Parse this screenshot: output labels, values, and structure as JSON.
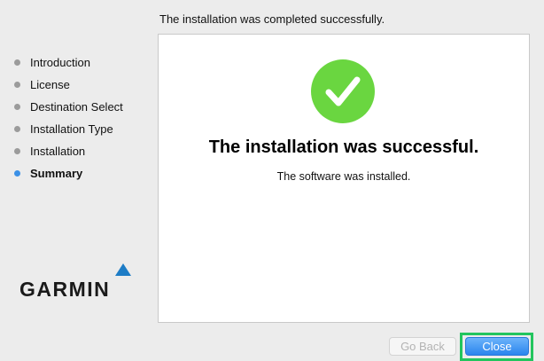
{
  "header": {
    "status_text": "The installation was completed successfully."
  },
  "sidebar": {
    "steps": [
      {
        "label": "Introduction",
        "state": "done"
      },
      {
        "label": "License",
        "state": "done"
      },
      {
        "label": "Destination Select",
        "state": "done"
      },
      {
        "label": "Installation Type",
        "state": "done"
      },
      {
        "label": "Installation",
        "state": "done"
      },
      {
        "label": "Summary",
        "state": "current"
      }
    ],
    "logo_text": "GARMIN"
  },
  "main": {
    "icon": "success-check-icon",
    "title": "The installation was successful.",
    "subtitle": "The software was installed."
  },
  "footer": {
    "back_label": "Go Back",
    "back_enabled": false,
    "close_label": "Close"
  },
  "colors": {
    "success_green": "#6ad640",
    "active_step": "#3b90e6",
    "primary_button": "#2a85ee",
    "logo_blue": "#1d7cc6",
    "highlight": "#22c55e"
  }
}
